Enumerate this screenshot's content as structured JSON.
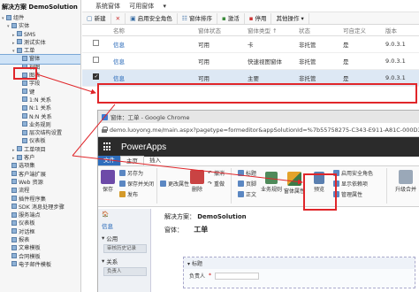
{
  "solution_tree": {
    "title": "解决方案 DemoSolution",
    "items": [
      {
        "label": "组件",
        "indent": 0,
        "toggle": "▾"
      },
      {
        "label": "实体",
        "indent": 1,
        "toggle": "▾"
      },
      {
        "label": "SMS",
        "indent": 2,
        "toggle": "▸"
      },
      {
        "label": "测试实体",
        "indent": 2,
        "toggle": "▸"
      },
      {
        "label": "工单",
        "indent": 2,
        "toggle": "▾"
      },
      {
        "label": "窗体",
        "indent": 3,
        "toggle": ""
      },
      {
        "label": "视图",
        "indent": 3,
        "toggle": ""
      },
      {
        "label": "图表",
        "indent": 3,
        "toggle": ""
      },
      {
        "label": "字段",
        "indent": 3,
        "toggle": ""
      },
      {
        "label": "键",
        "indent": 3,
        "toggle": ""
      },
      {
        "label": "1:N 关系",
        "indent": 3,
        "toggle": ""
      },
      {
        "label": "N:1 关系",
        "indent": 3,
        "toggle": ""
      },
      {
        "label": "N:N 关系",
        "indent": 3,
        "toggle": ""
      },
      {
        "label": "业务规则",
        "indent": 3,
        "toggle": ""
      },
      {
        "label": "层次结构设置",
        "indent": 3,
        "toggle": ""
      },
      {
        "label": "仪表板",
        "indent": 3,
        "toggle": ""
      },
      {
        "label": "工单项目",
        "indent": 2,
        "toggle": "▸"
      },
      {
        "label": "客户",
        "indent": 2,
        "toggle": "▸"
      },
      {
        "label": "选项集",
        "indent": 1,
        "toggle": ""
      },
      {
        "label": "客户端扩展",
        "indent": 1,
        "toggle": ""
      },
      {
        "label": "Web 资源",
        "indent": 1,
        "toggle": ""
      },
      {
        "label": "流程",
        "indent": 1,
        "toggle": ""
      },
      {
        "label": "插件程序集",
        "indent": 1,
        "toggle": ""
      },
      {
        "label": "SDK 消息处理步骤",
        "indent": 1,
        "toggle": ""
      },
      {
        "label": "服务端点",
        "indent": 1,
        "toggle": ""
      },
      {
        "label": "仪表板",
        "indent": 1,
        "toggle": ""
      },
      {
        "label": "对话框",
        "indent": 1,
        "toggle": ""
      },
      {
        "label": "报表",
        "indent": 1,
        "toggle": ""
      },
      {
        "label": "文章模板",
        "indent": 1,
        "toggle": ""
      },
      {
        "label": "合同模板",
        "indent": 1,
        "toggle": ""
      },
      {
        "label": "电子邮件模板",
        "indent": 1,
        "toggle": ""
      }
    ]
  },
  "breadcrumb": {
    "part1": "系统窗体",
    "part2": "可用窗体",
    "chevron": "▾"
  },
  "toolbar": {
    "new": "新建",
    "delete": "✕",
    "enable_security": "启用安全角色",
    "form_order": "窗体排序",
    "activate": "激活",
    "deactivate": "停用",
    "more": "其他操作"
  },
  "grid": {
    "headers": [
      "名称",
      "窗体状态",
      "窗体类型 ↑",
      "状态",
      "可自定义",
      "版本"
    ],
    "rows": [
      {
        "name": "信息",
        "status": "可用",
        "type": "卡",
        "state": "非托管",
        "custom": "是",
        "version": "9.0.3.1",
        "selected": false
      },
      {
        "name": "信息",
        "status": "可用",
        "type": "快速视图窗体",
        "state": "非托管",
        "custom": "是",
        "version": "9.0.3.1",
        "selected": false
      },
      {
        "name": "信息",
        "status": "可用",
        "type": "主要",
        "state": "非托管",
        "custom": "是",
        "version": "9.0.3.1",
        "selected": true
      }
    ]
  },
  "chrome": {
    "tab_title": "窗体：工单 - Google Chrome",
    "url": "demo.luoyong.me/main.aspx?pagetype=formeditor&appSolutionId=%7b55758275-C343-E911-A81C-000D3..."
  },
  "powerapps": {
    "title": "PowerApps",
    "tabs": {
      "file": "文件",
      "home": "主页",
      "insert": "插入"
    }
  },
  "ribbon": {
    "save": "保存",
    "save_as": "另存为",
    "save_close": "保存并关闭",
    "publish": "发布",
    "change_props": "更改属性",
    "delete": "删除",
    "undo": "撤消",
    "redo": "重做",
    "header": "标题",
    "footer": "页脚",
    "body": "正文",
    "business_rules": "业务规则",
    "form_props": "窗体属性",
    "preview": "预览",
    "enable_security": "启用安全角色",
    "show_deps": "显示依赖项",
    "manage_props": "管理属性",
    "upgrade": "升级",
    "merge": "合并"
  },
  "form_editor": {
    "solution_label": "解决方案：",
    "solution_name": "DemoSolution",
    "form_label": "窗体：",
    "form_name": "工单",
    "nav_home": "🏠",
    "nav_info": "信息",
    "common_label": "公用",
    "common_item": "审核历史记录",
    "related_label": "关系",
    "related_item": "负责人",
    "section_title": "标题",
    "field_label": "负责人",
    "required_mark": "*"
  },
  "colors": {
    "highlight": "#e0262a",
    "powerapps_bar": "#2b2b2b",
    "file_tab": "#2f6ebd"
  }
}
